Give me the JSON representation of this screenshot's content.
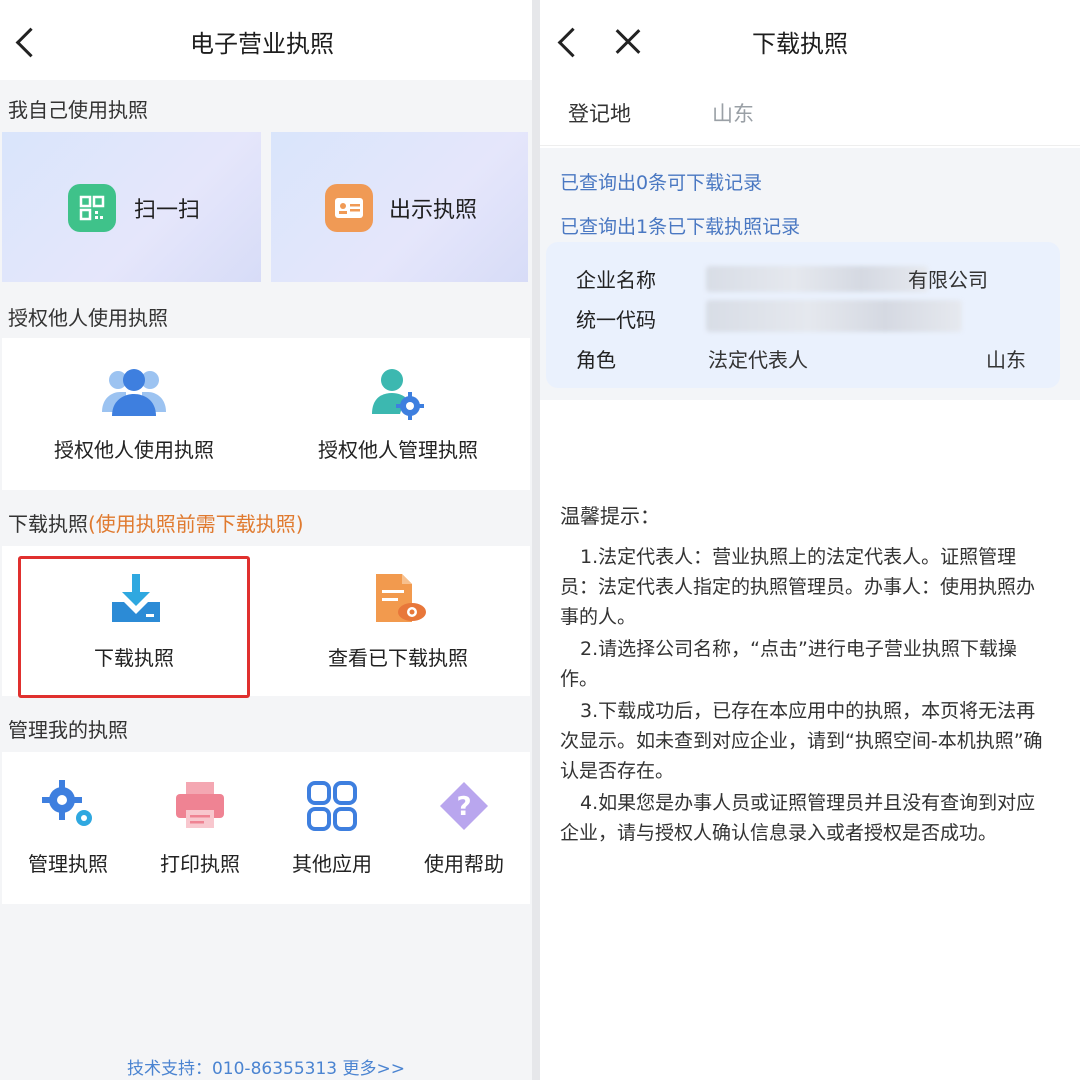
{
  "left": {
    "header": {
      "title": "电子营业执照"
    },
    "section_self": "我自己使用执照",
    "tiles": {
      "scan": "扫一扫",
      "show": "出示执照"
    },
    "section_auth": "授权他人使用执照",
    "auth": {
      "use": "授权他人使用执照",
      "manage": "授权他人管理执照"
    },
    "section_download": "下载执照",
    "section_download_note": "(使用执照前需下载执照)",
    "download": {
      "download": "下载执照",
      "view": "查看已下载执照"
    },
    "section_manage": "管理我的执照",
    "manage": {
      "manage": "管理执照",
      "print": "打印执照",
      "other": "其他应用",
      "help": "使用帮助"
    },
    "footer": "技术支持：010-86355313 更多>>"
  },
  "right": {
    "header": {
      "title": "下载执照"
    },
    "registration": {
      "label": "登记地",
      "value": "山东"
    },
    "query_downloadable": "已查询出0条可下载记录",
    "query_downloaded": "已查询出1条已下载执照记录",
    "record": {
      "name_label": "企业名称",
      "name_value_visible": "有限公司",
      "code_label": "统一代码",
      "role_label": "角色",
      "role_value": "法定代表人",
      "region": "山东"
    },
    "tips": {
      "title": "温馨提示：",
      "items": [
        "1.法定代表人：营业执照上的法定代表人。证照管理员：法定代表人指定的执照管理员。办事人：使用执照办事的人。",
        "2.请选择公司名称，“点击”进行电子营业执照下载操作。",
        "3.下载成功后，已存在本应用中的执照，本页将无法再次显示。如未查到对应企业，请到“执照空间-本机执照”确认是否存在。",
        "4.如果您是办事人员或证照管理员并且没有查询到对应企业，请与授权人确认信息录入或者授权是否成功。"
      ]
    }
  },
  "colors": {
    "accent_blue": "#4b84d1",
    "warn_orange": "#e07a2f",
    "highlight_red": "#e0302e",
    "scan_green": "#3fc28a",
    "show_orange": "#f09a55"
  }
}
